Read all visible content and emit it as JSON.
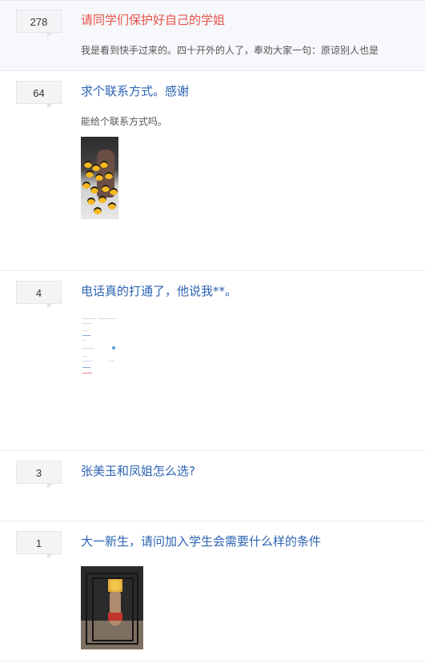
{
  "posts": [
    {
      "reply_count": "278",
      "title": "请同学们保护好自己的学姐",
      "excerpt": "我是看到快手过来的。四十开外的人了，奉劝大家一句：原谅别人也是",
      "hot": true,
      "has_image": false
    },
    {
      "reply_count": "64",
      "title": "求个联系方式。感谢",
      "excerpt": "能给个联系方式吗。",
      "has_image": true,
      "image": "phone-video-frame-with-emoji-stickers"
    },
    {
      "reply_count": "4",
      "title": "电话真的打通了，他说我**。",
      "excerpt": "",
      "has_image": true,
      "image": "phone-app-screenshot"
    },
    {
      "reply_count": "3",
      "title": "张美玉和凤姐怎么选?",
      "excerpt": "",
      "has_image": false
    },
    {
      "reply_count": "1",
      "title": "大一新生，请问加入学生会需要什么样的条件",
      "excerpt": "",
      "has_image": true,
      "image": "gym-photo-with-blurred-face"
    }
  ],
  "colors": {
    "title_link": "#2d64b3",
    "title_hot": "#e8534a",
    "excerpt_text": "#555555",
    "row_highlight_bg": "#f6f8fb",
    "divider": "#e8ebf0"
  }
}
